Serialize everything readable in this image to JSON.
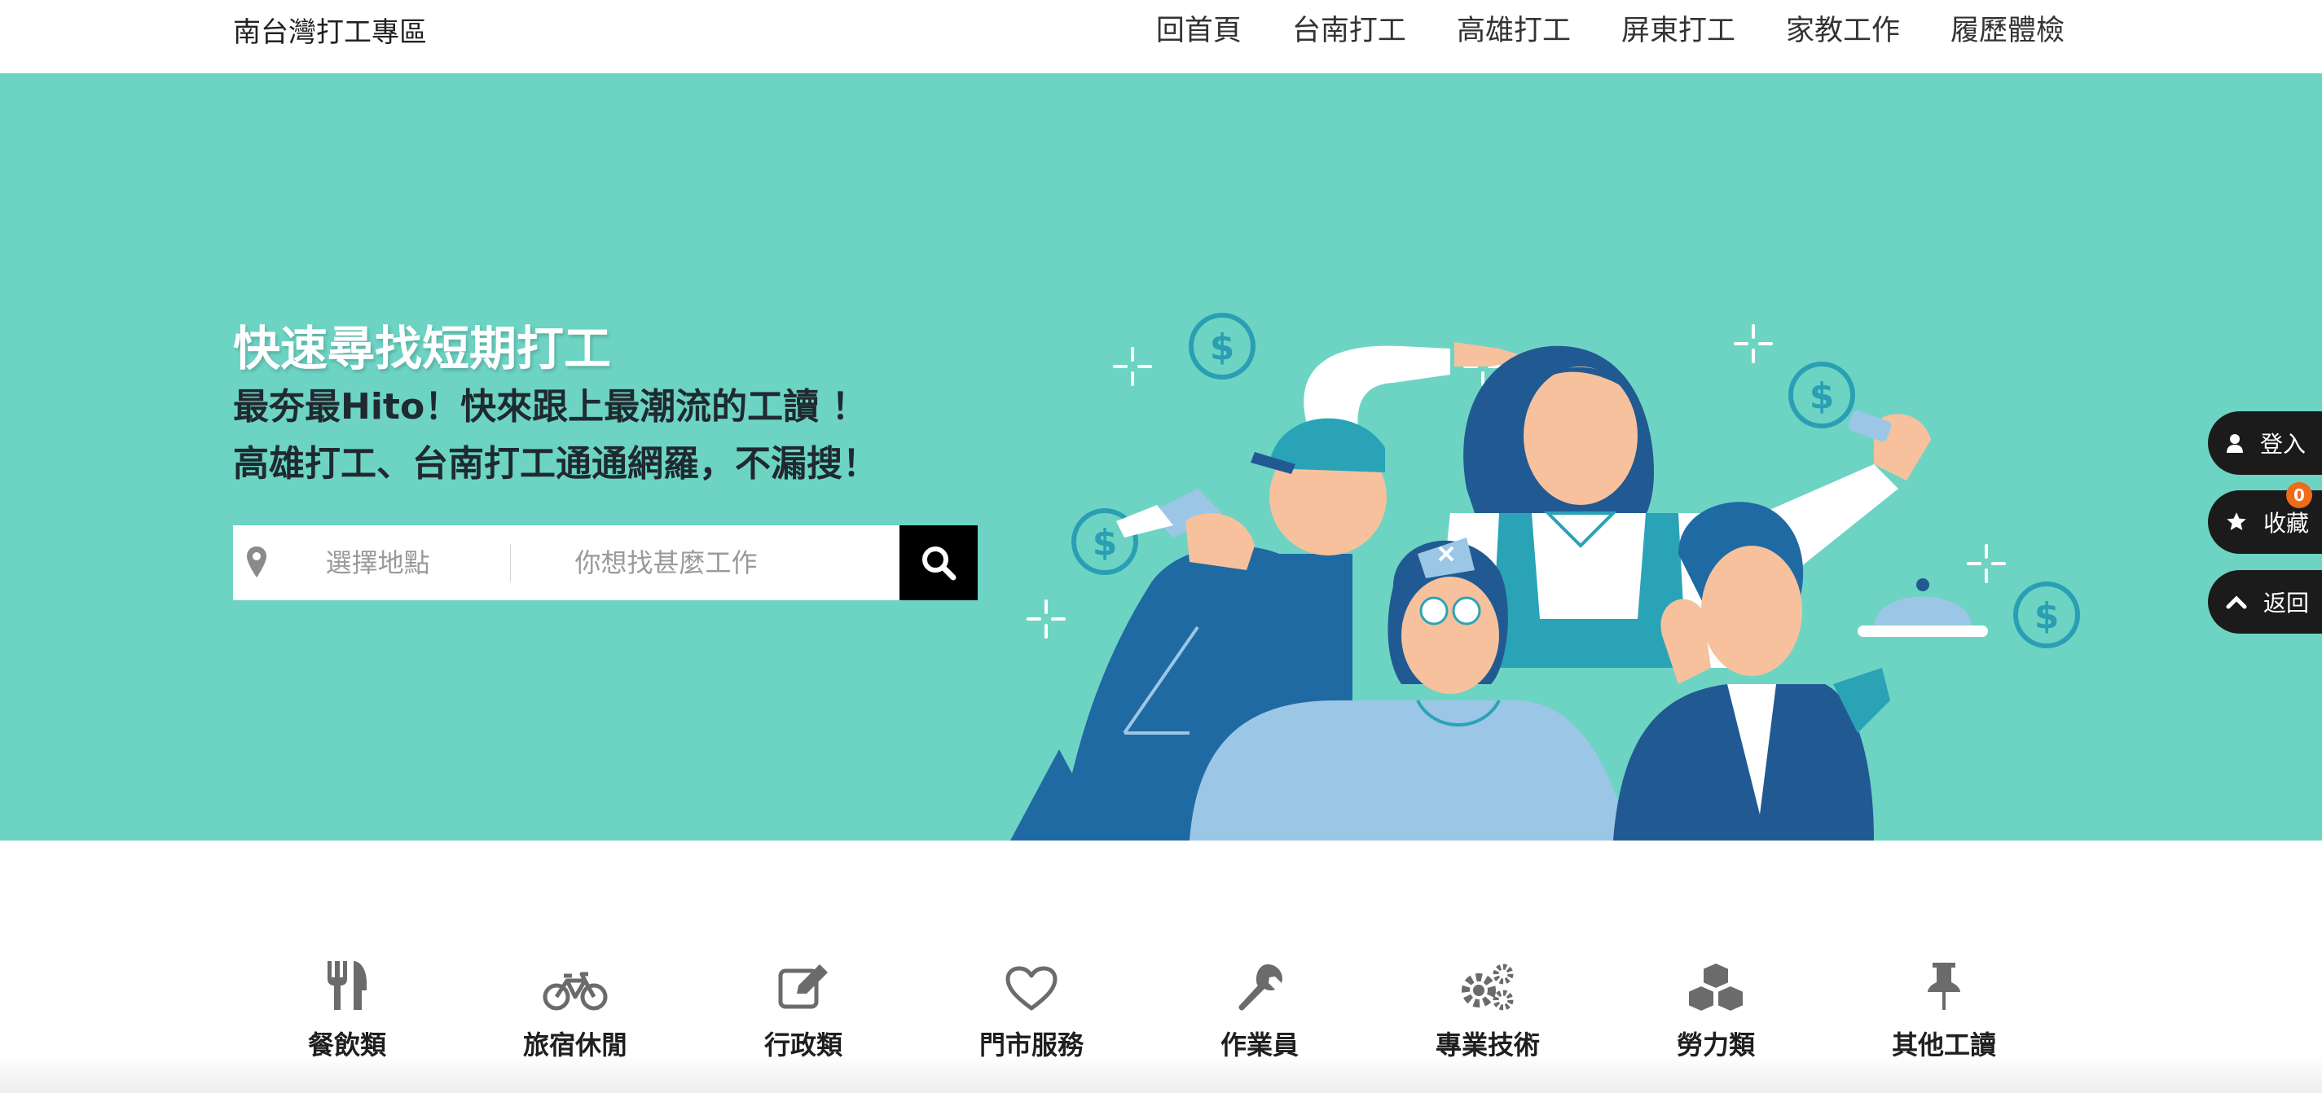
{
  "header": {
    "brand": "南台灣打工專區",
    "nav": [
      "回首頁",
      "台南打工",
      "高雄打工",
      "屏東打工",
      "家教工作",
      "履歷體檢"
    ]
  },
  "hero": {
    "title": "快速尋找短期打工",
    "line1": "最夯最Hito！快來跟上最潮流的工讀 ！",
    "line2": "高雄打工、台南打工通通網羅，不漏搜！",
    "background": "#6dd4c4"
  },
  "search": {
    "location_placeholder": "選擇地點",
    "job_placeholder": "你想找甚麼工作",
    "pin_icon": "map-pin-icon",
    "button_icon": "search-icon"
  },
  "floating": {
    "login": "登入",
    "favorites": "收藏",
    "favorites_count": "0",
    "back": "返回"
  },
  "categories": [
    {
      "label": "餐飲類",
      "icon": "utensils-icon"
    },
    {
      "label": "旅宿休閒",
      "icon": "bicycle-icon"
    },
    {
      "label": "行政類",
      "icon": "edit-icon"
    },
    {
      "label": "門市服務",
      "icon": "heart-icon"
    },
    {
      "label": "作業員",
      "icon": "wrench-icon"
    },
    {
      "label": "專業技術",
      "icon": "gears-icon"
    },
    {
      "label": "勞力類",
      "icon": "cubes-icon"
    },
    {
      "label": "其他工讀",
      "icon": "pushpin-icon"
    }
  ]
}
